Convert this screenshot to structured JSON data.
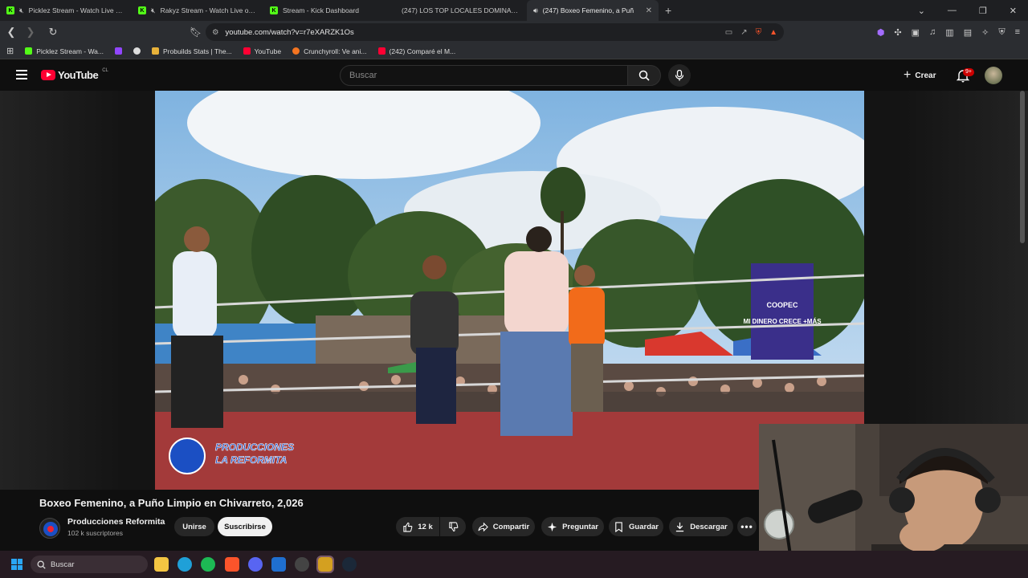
{
  "browser": {
    "tabs": [
      {
        "title": "Picklez Stream - Watch Live on Ki",
        "type": "kick",
        "muted": true
      },
      {
        "title": "Rakyz Stream - Watch Live on Ki",
        "type": "kick",
        "muted": true
      },
      {
        "title": "Stream - Kick Dashboard",
        "type": "kick",
        "muted": false
      },
      {
        "title": "(247) LOS TOP LOCALES DOMINAN e",
        "type": "youtube",
        "muted": false
      },
      {
        "title": "(247) Boxeo Femenino, a Puñ",
        "type": "youtube",
        "active": true,
        "audio": true
      }
    ],
    "url": "youtube.com/watch?v=r7eXARZK1Os",
    "bookmarks": [
      {
        "label": "Picklez Stream - Wa...",
        "icon": "kick-icon",
        "color": "#53fc18"
      },
      {
        "label": "",
        "icon": "twitch-icon",
        "color": "#9146ff"
      },
      {
        "label": "",
        "icon": "eye-icon",
        "color": "#dddddd"
      },
      {
        "label": "Probuilds Stats | The...",
        "icon": "probuilds-icon",
        "color": "#e8b23a"
      },
      {
        "label": "YouTube",
        "icon": "youtube-icon",
        "color": "#ff0033"
      },
      {
        "label": "Crunchyroll: Ve ani...",
        "icon": "crunchyroll-icon",
        "color": "#f47521"
      },
      {
        "label": "(242) Comparé el M...",
        "icon": "youtube-icon",
        "color": "#ff0033"
      }
    ]
  },
  "youtube": {
    "logo_text": "YouTube",
    "country": "CL",
    "search_placeholder": "Buscar",
    "create_label": "Crear",
    "notif_badge": "9+",
    "video": {
      "title": "Boxeo Femenino, a Puño Limpio en Chivarreto, 2,026",
      "watermark": "PRODUCCIONES LA REFORMITA",
      "banner_text": "MI DINERO CRECE +MÁS",
      "banner_brand": "COOPEC"
    },
    "channel": {
      "name": "Producciones  Reformita",
      "subscribers": "102 k suscriptores"
    },
    "actions": {
      "join": "Unirse",
      "subscribe": "Suscribirse",
      "likes": "12 k",
      "share": "Compartir",
      "ask": "Preguntar",
      "save": "Guardar",
      "download": "Descargar"
    }
  },
  "taskbar": {
    "search_label": "Buscar",
    "accent": "#2aa6f5"
  }
}
